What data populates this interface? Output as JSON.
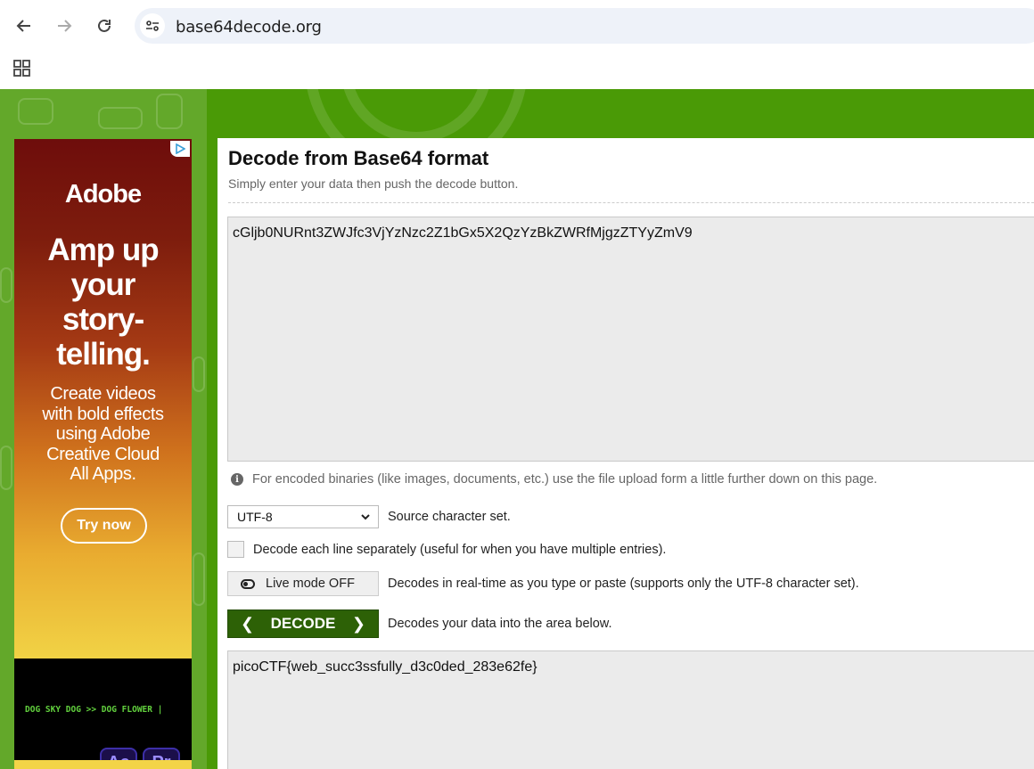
{
  "browser": {
    "url": "base64decode.org",
    "back_icon": "arrow-left-icon",
    "forward_icon": "arrow-right-icon",
    "reload_icon": "reload-icon",
    "site_info_icon": "tune-icon",
    "apps_icon": "apps-grid-icon"
  },
  "ad": {
    "brand": "Adobe",
    "headline": [
      "Amp up",
      "your",
      "story-",
      "telling."
    ],
    "body": [
      "Create videos",
      "with bold effects",
      "using Adobe",
      "Creative Cloud",
      "All Apps."
    ],
    "cta": "Try now",
    "ticker": "DOG SKY DOG >> DOG FLOWER |",
    "app_icons": [
      "Ae",
      "Pr"
    ]
  },
  "main": {
    "title": "Decode from Base64 format",
    "subtitle": "Simply enter your data then push the decode button.",
    "input_value": "cGljb0NURnt3ZWJfc3VjYzNzc2Z1bGx5X2QzYzBkZWRfMjgzZTYyZmV9",
    "binary_note": "For encoded binaries (like images, documents, etc.) use the file upload form a little further down on this page.",
    "charset_value": "UTF-8",
    "charset_label": "Source character set.",
    "line_option_label": "Decode each line separately (useful for when you have multiple entries).",
    "live_mode_label": "Live mode OFF",
    "live_mode_desc": "Decodes in real-time as you type or paste (supports only the UTF-8 character set).",
    "decode_label": "DECODE",
    "decode_desc": "Decodes your data into the area below.",
    "output_value": "picoCTF{web_succ3ssfully_d3c0ded_283e62fe}"
  },
  "colors": {
    "header_green": "#4a9a06",
    "decode_button": "#2d6106"
  }
}
